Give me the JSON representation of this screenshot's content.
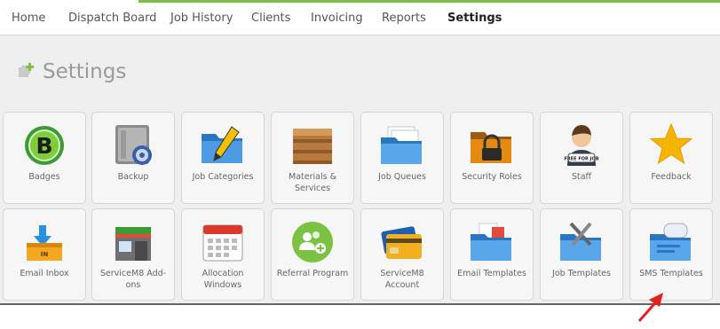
{
  "nav": {
    "items": [
      "Home",
      "Dispatch Board",
      "Job History",
      "Clients",
      "Invoicing",
      "Reports",
      "Settings"
    ],
    "active": "Settings"
  },
  "page": {
    "title": "Settings"
  },
  "tiles": [
    {
      "label": "Badges",
      "icon": "badge-icon"
    },
    {
      "label": "Backup",
      "icon": "backup-safe-icon"
    },
    {
      "label": "Job Categories",
      "icon": "folder-pencil-icon"
    },
    {
      "label": "Materials & Services",
      "icon": "crate-icon"
    },
    {
      "label": "Job Queues",
      "icon": "file-folders-icon"
    },
    {
      "label": "Security Roles",
      "icon": "padlock-folder-icon"
    },
    {
      "label": "Staff",
      "icon": "staff-person-icon"
    },
    {
      "label": "Feedback",
      "icon": "star-icon"
    },
    {
      "label": "Email Inbox",
      "icon": "inbox-tray-icon"
    },
    {
      "label": "ServiceM8 Add-ons",
      "icon": "storefront-icon"
    },
    {
      "label": "Allocation Windows",
      "icon": "calendar-icon"
    },
    {
      "label": "Referral Program",
      "icon": "people-plus-icon"
    },
    {
      "label": "ServiceM8 Account",
      "icon": "credit-card-icon"
    },
    {
      "label": "Email Templates",
      "icon": "mail-folder-icon"
    },
    {
      "label": "Job Templates",
      "icon": "tools-folder-icon"
    },
    {
      "label": "SMS Templates",
      "icon": "chat-folder-icon"
    }
  ],
  "colors": {
    "accent": "#7cc242",
    "arrow": "#e0231b",
    "folder": "#3f8fd7"
  },
  "staff_badge_text": "FREE FOR JOB",
  "inbox_label_text": "IN"
}
